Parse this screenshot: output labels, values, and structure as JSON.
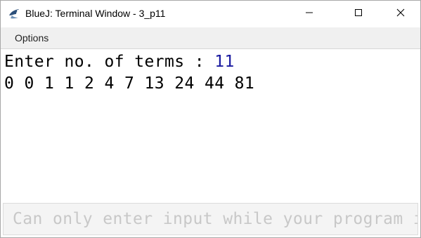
{
  "window": {
    "title": "BlueJ: Terminal Window - 3_p11",
    "app_icon": "bluej-bird-icon",
    "controls": {
      "minimize": "minimize-icon",
      "maximize": "maximize-icon",
      "close": "close-icon"
    }
  },
  "menubar": {
    "options_label": "Options"
  },
  "terminal": {
    "prompt": "Enter no. of terms : ",
    "user_input": "11",
    "output": "0 0 1 1 2 4 7 13 24 44 81"
  },
  "input_field": {
    "placeholder": "Can only enter input while your program is running"
  },
  "colors": {
    "input_echo": "#1a1aa0",
    "placeholder": "#c8c8c8",
    "menubar_bg": "#f0f0f0"
  }
}
